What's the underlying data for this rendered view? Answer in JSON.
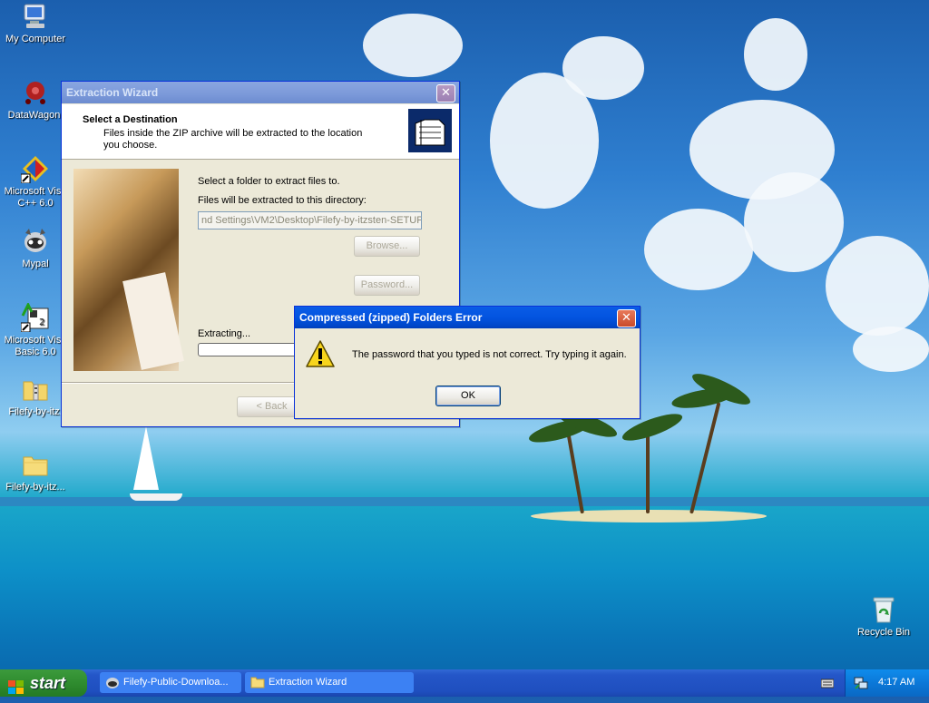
{
  "desktop": {
    "icons": [
      {
        "label": "My Computer",
        "icon": "computer-icon"
      },
      {
        "label": "DataWagon.",
        "icon": "datawagon-icon"
      },
      {
        "label": "Microsoft Visu C++ 6.0",
        "icon": "visual-cpp-icon"
      },
      {
        "label": "Mypal",
        "icon": "mypal-browser-icon"
      },
      {
        "label": "Microsoft Visu Basic 6.0",
        "icon": "visual-basic-icon"
      },
      {
        "label": "Filefy-by-itz.",
        "icon": "zip-folder-icon"
      },
      {
        "label": "Filefy-by-itz...",
        "icon": "folder-icon"
      },
      {
        "label": "Recycle Bin",
        "icon": "recycle-bin-icon"
      }
    ]
  },
  "wizard": {
    "title": "Extraction Wizard",
    "close": "✕",
    "header_title": "Select a Destination",
    "header_desc": "Files inside the ZIP archive will be extracted to the location you choose.",
    "select_label": "Select a folder to extract files to.",
    "dir_label": "Files will be extracted to this directory:",
    "dir_value": "nd Settings\\VM2\\Desktop\\Filefy-by-itzsten-SETUP",
    "browse_label": "Browse...",
    "password_label": "Password...",
    "extracting_label": "Extracting...",
    "progress": 0.0,
    "back_label": "< Back"
  },
  "error_dialog": {
    "title": "Compressed (zipped) Folders Error",
    "close": "✕",
    "message": "The password that you typed is not correct.  Try typing it again.",
    "ok_label": "OK",
    "icon": "warning-icon"
  },
  "taskbar": {
    "start_label": "start",
    "tasks": [
      {
        "label": "Filefy-Public-Downloa...",
        "icon": "mypal-browser-icon"
      },
      {
        "label": "Extraction Wizard",
        "icon": "folder-icon"
      }
    ],
    "clock": "4:17 AM"
  },
  "colors": {
    "title_active": "#0354e0",
    "title_inactive": "#7b99d9",
    "window_bg": "#ece9d8",
    "start_green": "#2f8c2f",
    "taskbar_blue": "#2456c8"
  }
}
